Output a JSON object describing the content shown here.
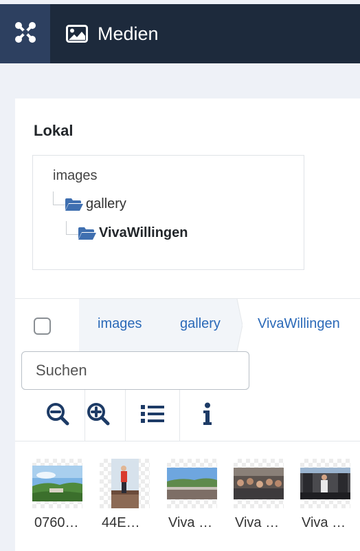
{
  "header": {
    "title": "Medien",
    "logo_icon": "joomla-logo-icon",
    "title_icon": "image-icon",
    "background": "#1d2a3c",
    "logo_background": "#2d4060"
  },
  "sidebar": {
    "section_title": "Lokal",
    "tree": {
      "root": "images",
      "children": [
        {
          "label": "gallery",
          "icon": "folder-open-icon"
        },
        {
          "label": "VivaWillingen",
          "icon": "folder-open-icon",
          "active": true
        }
      ]
    }
  },
  "browser": {
    "breadcrumbs": [
      "images",
      "gallery",
      "VivaWillingen"
    ],
    "search_placeholder": "Suchen",
    "toolbar": [
      {
        "icon": "zoom-out-icon"
      },
      {
        "icon": "zoom-in-icon"
      },
      {
        "icon": "list-view-icon"
      },
      {
        "icon": "info-icon"
      }
    ],
    "items": [
      {
        "label": "0760…"
      },
      {
        "label": "44E…"
      },
      {
        "label": "Viva …"
      },
      {
        "label": "Viva …"
      },
      {
        "label": "Viva …"
      }
    ]
  },
  "colors": {
    "accent": "#2a69b8",
    "folder": "#3f6fb0",
    "icon_dark": "#1d3b66"
  }
}
